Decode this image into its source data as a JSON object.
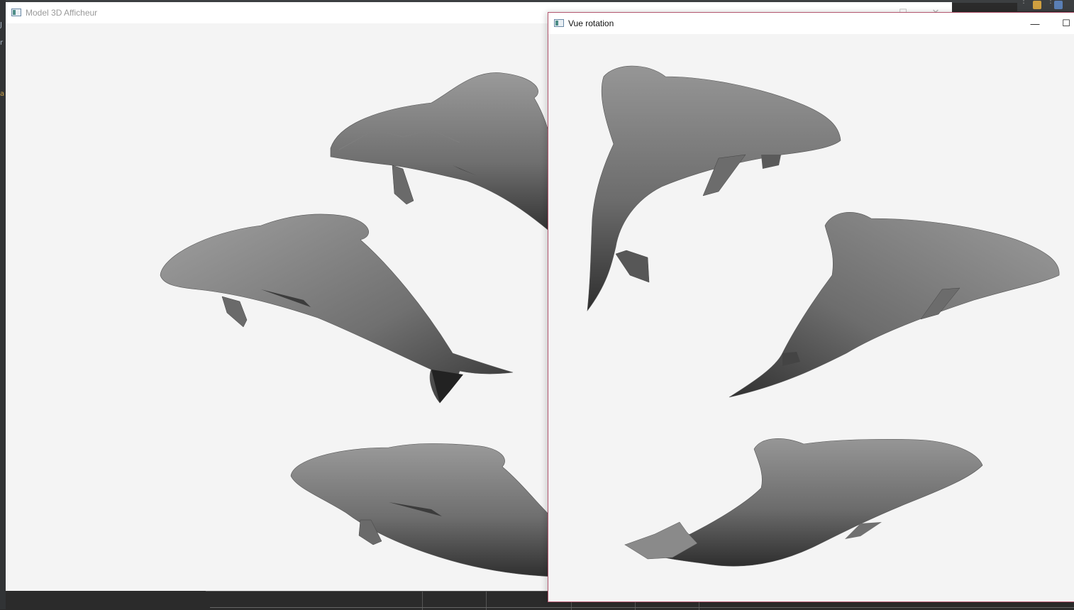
{
  "background_app": {
    "left_strip_chars": [
      "J",
      "r",
      "a"
    ]
  },
  "windows": {
    "main": {
      "title": "Model 3D Afficheur",
      "icon": "app-window-icon",
      "controls": [
        "restore-icon",
        "close-icon"
      ],
      "canvas_content": "rendered 3D dolphin models (3 visible instances, gray faceted mesh)"
    },
    "rotation": {
      "title": "Vue rotation",
      "icon": "app-window-icon",
      "controls": [
        "minimize-icon",
        "maximize-icon"
      ],
      "canvas_content": "rotated views of the 3D dolphin model (3 instances)"
    }
  },
  "colors": {
    "canvas_bg": "#f4f4f4",
    "mesh_light": "#8c8c8c",
    "mesh_mid": "#6e6e6e",
    "mesh_dark": "#3a3a3a",
    "active_border": "#b4576f"
  }
}
